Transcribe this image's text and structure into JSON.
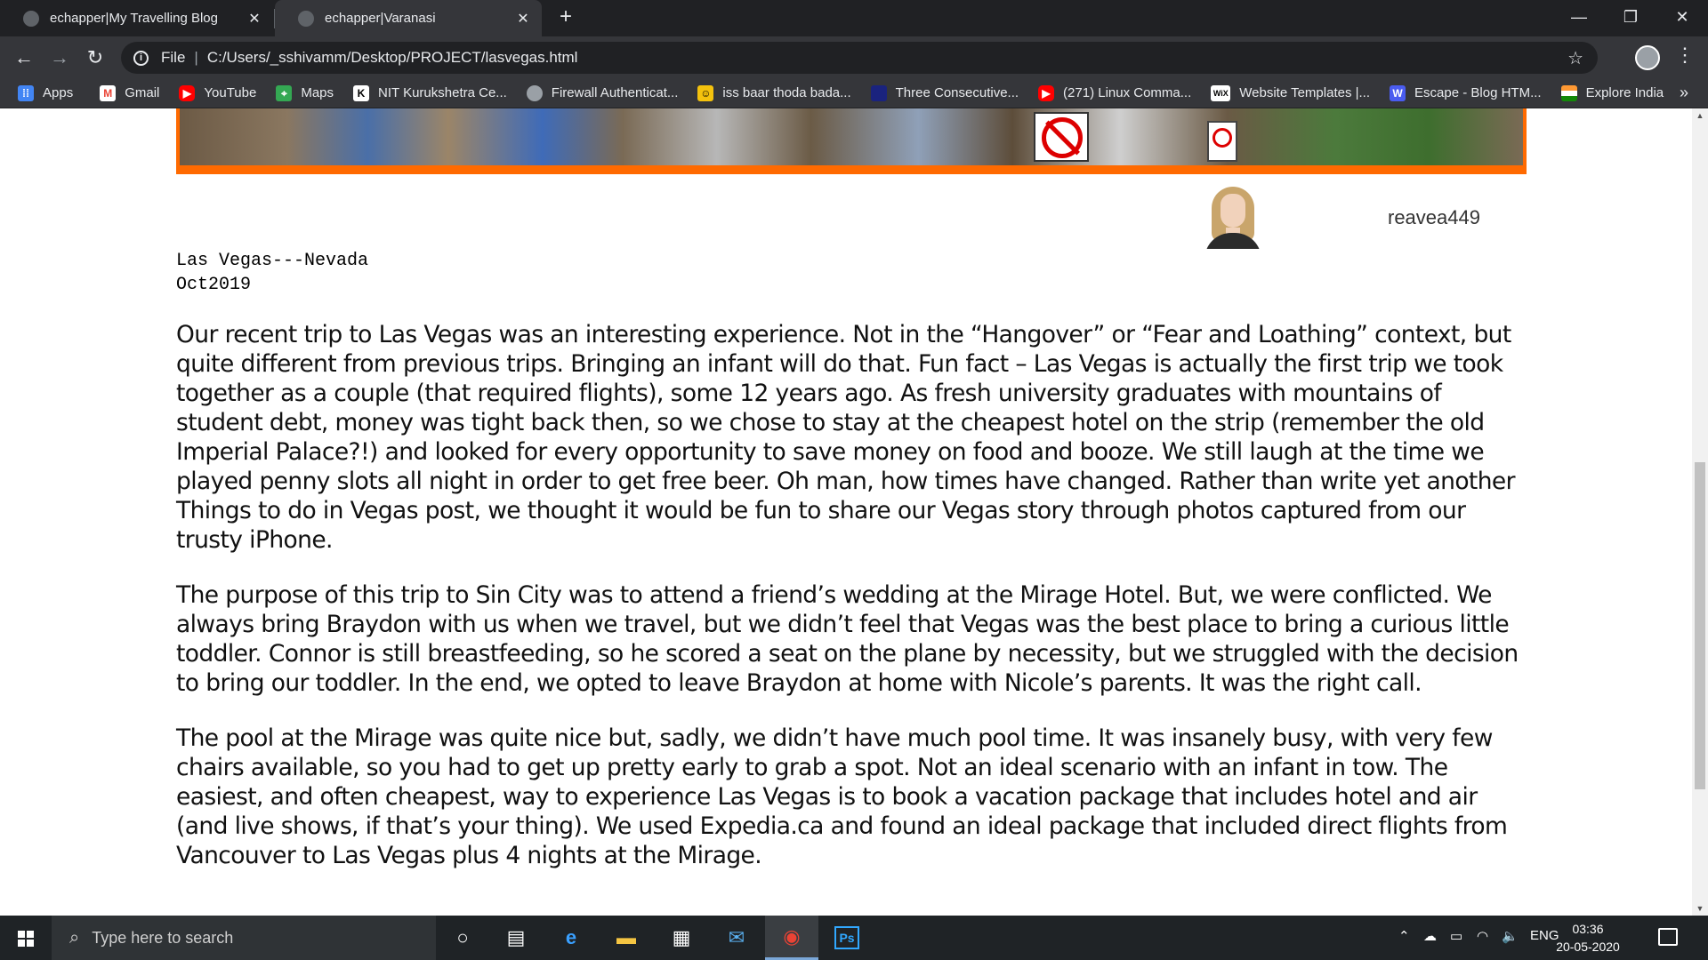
{
  "browser": {
    "tabs": [
      {
        "title": "echapper|My Travelling Blog",
        "active": false
      },
      {
        "title": "echapper|Varanasi",
        "active": true
      }
    ],
    "new_tab_symbol": "+",
    "window_controls": {
      "minimize": "—",
      "restore": "❐",
      "close": "✕"
    },
    "address": {
      "scheme_label": "File",
      "url": "C:/Users/_sshivamm/Desktop/PROJECT/lasvegas.html"
    },
    "bookmarks": [
      {
        "label": "Apps",
        "icon": "apps-grid-icon",
        "color": "#4285f4"
      },
      {
        "label": "Gmail",
        "icon": "gmail-icon",
        "color": "#ea4335"
      },
      {
        "label": "YouTube",
        "icon": "youtube-icon",
        "color": "#ff0000"
      },
      {
        "label": "Maps",
        "icon": "maps-icon",
        "color": "#34a853"
      },
      {
        "label": "NIT Kurukshetra Ce...",
        "icon": "nit-k-icon",
        "color": "#ffffff"
      },
      {
        "label": "Firewall Authenticat...",
        "icon": "globe-icon",
        "color": "#9aa0a6"
      },
      {
        "label": "iss baar thoda bada...",
        "icon": "emoji-icon",
        "color": "#f4c20d"
      },
      {
        "label": "Three Consecutive...",
        "icon": "page-icon",
        "color": "#1a237e"
      },
      {
        "label": "(271) Linux Comma...",
        "icon": "youtube-icon",
        "color": "#ff0000"
      },
      {
        "label": "Website Templates |...",
        "icon": "wix-icon",
        "color": "#ffffff"
      },
      {
        "label": "Escape - Blog HTM...",
        "icon": "w-icon",
        "color": "#4a5cf0"
      },
      {
        "label": "Explore India",
        "icon": "india-flag-icon",
        "color": "#ff9933"
      }
    ],
    "bookmarks_more": "»"
  },
  "page": {
    "author": "reavea449",
    "location": "Las Vegas---Nevada",
    "date": "Oct2019",
    "paragraphs": [
      "Our recent trip to Las Vegas was an interesting experience. Not in the “Hangover” or “Fear and Loathing” context, but quite different from previous trips. Bringing an infant will do that. Fun fact – Las Vegas is actually the first trip we took together as a couple (that required flights), some 12 years ago. As fresh university graduates with mountains of student debt, money was tight back then, so we chose to stay at the cheapest hotel on the strip (remember the old Imperial Palace?!) and looked for every opportunity to save money on food and booze. We still laugh at the time we played penny slots all night in order to get free beer. Oh man, how times have changed. Rather than write yet another Things to do in Vegas post, we thought it would be fun to share our Vegas story through photos captured from our trusty iPhone.",
      "The purpose of this trip to Sin City was to attend a friend’s wedding at the Mirage Hotel. But, we were conflicted. We always bring Braydon with us when we travel, but we didn’t feel that Vegas was the best place to bring a curious little toddler. Connor is still breastfeeding, so he scored a seat on the plane by necessity, but we struggled with the decision to bring our toddler. In the end, we opted to leave Braydon at home with Nicole’s parents. It was the right call.",
      "The pool at the Mirage was quite nice but, sadly, we didn’t have much pool time. It was insanely busy, with very few chairs available, so you had to get up pretty early to grab a spot. Not an ideal scenario with an infant in tow. The easiest, and often cheapest, way to experience Las Vegas is to book a vacation package that includes hotel and air (and live shows, if that’s your thing). We used Expedia.ca and found an ideal package that included direct flights from Vancouver to Las Vegas plus 4 nights at the Mirage."
    ],
    "banner_border_color": "#ff6a00"
  },
  "taskbar": {
    "search_placeholder": "Type here to search",
    "language": "ENG",
    "time": "03:36",
    "date": "20-05-2020"
  }
}
